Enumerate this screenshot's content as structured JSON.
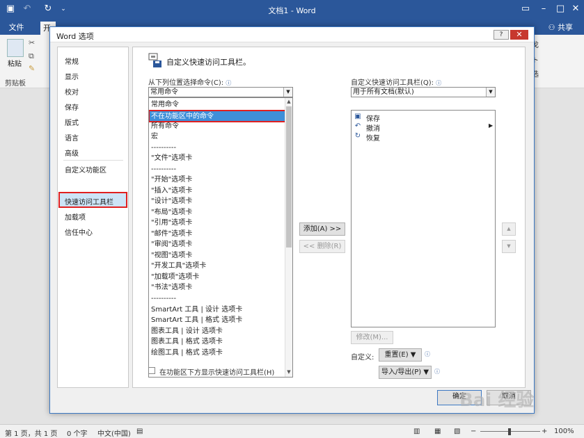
{
  "window": {
    "title": "文档1 - Word",
    "share": "共享"
  },
  "ribbon": {
    "file_tab": "文件",
    "home_tab": "开",
    "paste": "粘贴",
    "clipboard": "剪贴板",
    "side_labels": [
      "戈",
      "ト",
      "选"
    ]
  },
  "dialog": {
    "title": "Word 选项",
    "help": "?",
    "close": "✕",
    "nav": [
      "常规",
      "显示",
      "校对",
      "保存",
      "版式",
      "语言",
      "高级",
      "自定义功能区",
      "快速访问工具栏",
      "加载项",
      "信任中心"
    ],
    "heading": "自定义快速访问工具栏。",
    "choose_label": "从下列位置选择命令(C):",
    "choose_value": "常用命令",
    "command_list": [
      "常用命令",
      "不在功能区中的命令",
      "所有命令",
      "宏",
      "----------",
      "\"文件\"选项卡",
      "----------",
      "\"开始\"选项卡",
      "\"插入\"选项卡",
      "\"设计\"选项卡",
      "\"布局\"选项卡",
      "\"引用\"选项卡",
      "\"邮件\"选项卡",
      "\"审阅\"选项卡",
      "\"视图\"选项卡",
      "\"开发工具\"选项卡",
      "\"加载项\"选项卡",
      "\"书法\"选项卡",
      "----------",
      "SmartArt 工具 | 设计 选项卡",
      "SmartArt 工具 | 格式 选项卡",
      "图表工具 | 设计 选项卡",
      "图表工具 | 格式 选项卡",
      "绘图工具 | 格式 选项卡"
    ],
    "qat_label": "自定义快速访问工具栏(Q):",
    "qat_value": "用于所有文档(默认)",
    "qat_items": [
      "保存",
      "撤消",
      "恢复"
    ],
    "add_button": "添加(A) >>",
    "remove_button": "<< 删除(R)",
    "modify_button": "修改(M)...",
    "customize_label": "自定义:",
    "reset_button": "重置(E) ▼",
    "import_export_button": "导入/导出(P) ▼",
    "show_below_label": "在功能区下方显示快速访问工具栏(H)",
    "ok_button": "确定",
    "cancel_button": "取消"
  },
  "status": {
    "page": "第 1 页，共 1 页",
    "words": "0 个字",
    "lang": "中文(中国)",
    "zoom": "100%"
  },
  "watermark": "Bai 经验",
  "colors": {
    "word_blue": "#2b579a",
    "selection_blue": "#3e8fd9",
    "highlight_red": "#e02020"
  }
}
